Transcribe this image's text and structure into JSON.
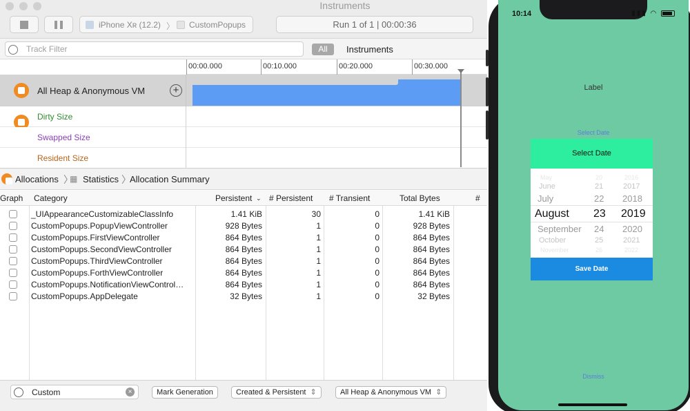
{
  "window": {
    "title": "Instruments"
  },
  "toolbar": {
    "device": "iPhone Xʀ (12.2)",
    "app": "CustomPopups",
    "run_info": "Run 1 of 1  |  00:00:36"
  },
  "filter": {
    "track_filter_placeholder": "Track Filter",
    "all_label": "All",
    "instruments_label": "Instruments"
  },
  "timeline": {
    "ticks": [
      "00:00.000",
      "00:10.000",
      "00:20.000",
      "00:30.000"
    ]
  },
  "tracks": {
    "heap_name": "All Heap & Anonymous VM",
    "sub": [
      {
        "label": "Dirty Size",
        "color": "#2e8b2e"
      },
      {
        "label": "Swapped Size",
        "color": "#8a3fb5"
      },
      {
        "label": "Resident Size",
        "color": "#b8651b"
      }
    ]
  },
  "breadcrumb": {
    "items": [
      "Allocations",
      "Statistics",
      "Allocation Summary"
    ]
  },
  "table": {
    "columns": [
      "Graph",
      "Category",
      "Persistent",
      "# Persistent",
      "# Transient",
      "Total Bytes",
      "#"
    ],
    "rows": [
      {
        "category": "_UIAppearanceCustomizableClassInfo",
        "persistent": "1.41 KiB",
        "n_persistent": "30",
        "n_transient": "0",
        "total": "1.41 KiB"
      },
      {
        "category": "CustomPopups.PopupViewController",
        "persistent": "928 Bytes",
        "n_persistent": "1",
        "n_transient": "0",
        "total": "928 Bytes"
      },
      {
        "category": "CustomPopups.FirstViewController",
        "persistent": "864 Bytes",
        "n_persistent": "1",
        "n_transient": "0",
        "total": "864 Bytes"
      },
      {
        "category": "CustomPopups.SecondViewController",
        "persistent": "864 Bytes",
        "n_persistent": "1",
        "n_transient": "0",
        "total": "864 Bytes"
      },
      {
        "category": "CustomPopups.ThirdViewController",
        "persistent": "864 Bytes",
        "n_persistent": "1",
        "n_transient": "0",
        "total": "864 Bytes"
      },
      {
        "category": "CustomPopups.ForthViewController",
        "persistent": "864 Bytes",
        "n_persistent": "1",
        "n_transient": "0",
        "total": "864 Bytes"
      },
      {
        "category": "CustomPopups.NotificationViewControl…",
        "persistent": "864 Bytes",
        "n_persistent": "1",
        "n_transient": "0",
        "total": "864 Bytes"
      },
      {
        "category": "CustomPopups.AppDelegate",
        "persistent": "32 Bytes",
        "n_persistent": "1",
        "n_transient": "0",
        "total": "32 Bytes"
      }
    ]
  },
  "bottom": {
    "filter_value": "Custom",
    "mark_generation": "Mark Generation",
    "lifespan": "Created & Persistent",
    "allocation_type": "All Heap & Anonymous VM"
  },
  "phone": {
    "time": "10:14",
    "label": "Label",
    "select_link": "Select Date",
    "popup_title": "Select Date",
    "picker": {
      "months": [
        "May",
        "June",
        "July",
        "August",
        "September",
        "October",
        "November"
      ],
      "days": [
        "20",
        "21",
        "22",
        "23",
        "24",
        "25",
        "26"
      ],
      "years": [
        "2016",
        "2017",
        "2018",
        "2019",
        "2020",
        "2021",
        "2022"
      ]
    },
    "save_label": "Save Date",
    "dismiss_label": "Dismiss"
  },
  "colors": {
    "heap_graph": "#5d9cf5",
    "instrument_orange": "#f08a23",
    "phone_bg": "#6ecaa3",
    "popup_header": "#2ded9e",
    "save_button": "#1a8be0"
  }
}
